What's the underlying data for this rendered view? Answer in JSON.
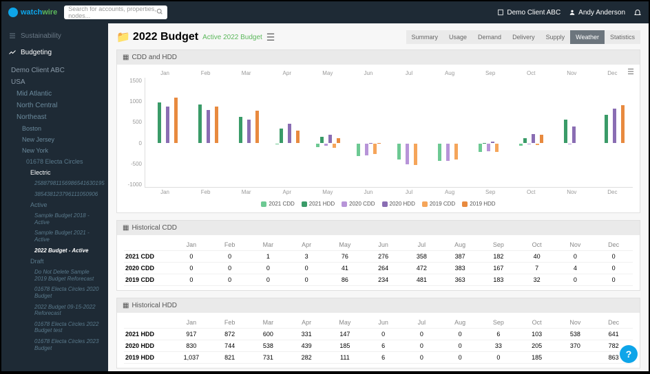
{
  "brand": {
    "a": "watch",
    "b": "wire"
  },
  "search": {
    "placeholder": "Search for accounts, properties, nodes..."
  },
  "top": {
    "client": "Demo Client ABC",
    "user": "Andy Anderson"
  },
  "nav": {
    "sustainability": "Sustainability",
    "budgeting": "Budgeting"
  },
  "tree": {
    "root": "Demo Client ABC",
    "usa": "USA",
    "r1": "Mid Atlantic",
    "r2": "North Central",
    "r3": "Northeast",
    "c1": "Boston",
    "c2": "New Jersey",
    "c3": "New York",
    "acct": "01678 Electa Circles",
    "elec": "Electric",
    "m1": "25887981156986541630195",
    "m2": "385438123796111050906",
    "active": "Active",
    "b1": "Sample Budget 2018 - Active",
    "b2": "Sample Budget 2021 - Active",
    "b3": "2022 Budget - Active",
    "draft": "Draft",
    "d1": "Do Not Delete Sample 2019 Budget Reforecast",
    "d2": "01678 Electa Circles 2020 Budget",
    "d3": "2022 Budget 09-15-2022 Reforecast",
    "d4": "01678 Electa Circles 2022 Budget test",
    "d5": "01678 Electa Circles 2023 Budget"
  },
  "page": {
    "title": "2022 Budget",
    "badge": "Active 2022 Budget"
  },
  "tabs": [
    "Summary",
    "Usage",
    "Demand",
    "Delivery",
    "Supply",
    "Weather",
    "Statistics"
  ],
  "activeTab": "Weather",
  "panels": {
    "p1": "CDD and HDD",
    "p2": "Historical CDD",
    "p3": "Historical HDD"
  },
  "months": [
    "Jan",
    "Feb",
    "Mar",
    "Apr",
    "May",
    "Jun",
    "Jul",
    "Aug",
    "Sep",
    "Oct",
    "Nov",
    "Dec"
  ],
  "legend": [
    "2021 CDD",
    "2021 HDD",
    "2020 CDD",
    "2020 HDD",
    "2019 CDD",
    "2019 HDD"
  ],
  "chart_data": {
    "type": "bar",
    "title": "CDD and HDD",
    "xlabel": "",
    "ylabel": "",
    "ylim": [
      -1000,
      1500
    ],
    "categories": [
      "Jan",
      "Feb",
      "Mar",
      "Apr",
      "May",
      "Jun",
      "Jul",
      "Aug",
      "Sep",
      "Oct",
      "Nov",
      "Dec"
    ],
    "series": [
      {
        "name": "2021 CDD",
        "values": [
          0,
          0,
          1,
          3,
          76,
          276,
          358,
          387,
          182,
          40,
          0,
          0
        ],
        "positive": false
      },
      {
        "name": "2021 HDD",
        "values": [
          917,
          872,
          600,
          331,
          147,
          0,
          0,
          0,
          6,
          103,
          538,
          641
        ],
        "positive": true
      },
      {
        "name": "2020 CDD",
        "values": [
          0,
          0,
          0,
          0,
          41,
          264,
          472,
          383,
          167,
          7,
          4,
          0
        ],
        "positive": false
      },
      {
        "name": "2020 HDD",
        "values": [
          830,
          744,
          538,
          439,
          185,
          6,
          0,
          0,
          33,
          205,
          370,
          782
        ],
        "positive": true
      },
      {
        "name": "2019 CDD",
        "values": [
          0,
          0,
          0,
          0,
          86,
          234,
          481,
          363,
          183,
          32,
          0,
          0
        ],
        "positive": false
      },
      {
        "name": "2019 HDD",
        "values": [
          1037,
          821,
          731,
          282,
          111,
          6,
          0,
          0,
          0,
          185,
          0,
          863
        ],
        "positive": true
      }
    ]
  },
  "cdd": {
    "rows": [
      {
        "label": "2021 CDD",
        "v": [
          "0",
          "0",
          "1",
          "3",
          "76",
          "276",
          "358",
          "387",
          "182",
          "40",
          "0",
          "0"
        ]
      },
      {
        "label": "2020 CDD",
        "v": [
          "0",
          "0",
          "0",
          "0",
          "41",
          "264",
          "472",
          "383",
          "167",
          "7",
          "4",
          "0"
        ]
      },
      {
        "label": "2019 CDD",
        "v": [
          "0",
          "0",
          "0",
          "0",
          "86",
          "234",
          "481",
          "363",
          "183",
          "32",
          "0",
          "0"
        ]
      }
    ]
  },
  "hdd": {
    "rows": [
      {
        "label": "2021 HDD",
        "v": [
          "917",
          "872",
          "600",
          "331",
          "147",
          "0",
          "0",
          "0",
          "6",
          "103",
          "538",
          "641"
        ]
      },
      {
        "label": "2020 HDD",
        "v": [
          "830",
          "744",
          "538",
          "439",
          "185",
          "6",
          "0",
          "0",
          "33",
          "205",
          "370",
          "782"
        ]
      },
      {
        "label": "2019 HDD",
        "v": [
          "1,037",
          "821",
          "731",
          "282",
          "111",
          "6",
          "0",
          "0",
          "0",
          "185",
          "",
          "863"
        ]
      }
    ]
  },
  "yticks": [
    "1500",
    "1000",
    "500",
    "0",
    "-500",
    "-1000"
  ],
  "colors": [
    "#6dc993",
    "#3a9b68",
    "#b794d8",
    "#8a6db3",
    "#f5a55a",
    "#e88a3f"
  ]
}
